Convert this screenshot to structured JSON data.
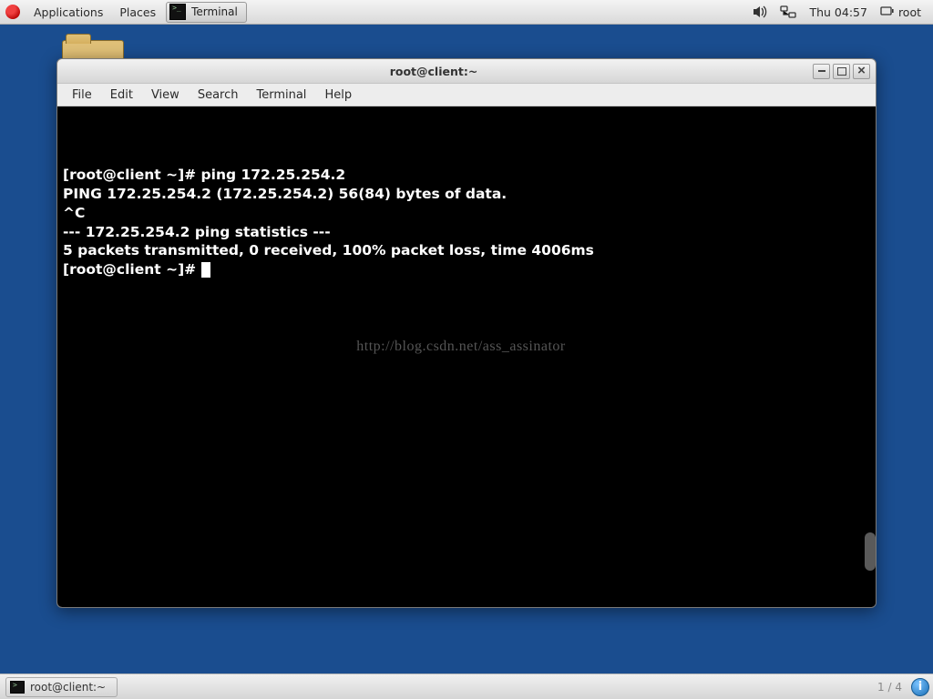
{
  "top_panel": {
    "applications": "Applications",
    "places": "Places",
    "task_terminal": "Terminal",
    "clock": "Thu 04:57",
    "user": "root"
  },
  "desktop": {
    "folder_visible": true
  },
  "window": {
    "title": "root@client:~",
    "menu": {
      "file": "File",
      "edit": "Edit",
      "view": "View",
      "search": "Search",
      "terminal": "Terminal",
      "help": "Help"
    }
  },
  "terminal": {
    "lines": [
      "[root@client ~]# ping 172.25.254.2",
      "PING 172.25.254.2 (172.25.254.2) 56(84) bytes of data.",
      "^C",
      "--- 172.25.254.2 ping statistics ---",
      "5 packets transmitted, 0 received, 100% packet loss, time 4006ms",
      "",
      "[root@client ~]# "
    ],
    "watermark": "http://blog.csdn.net/ass_assinator"
  },
  "bottom_panel": {
    "task": "root@client:~",
    "workspace": "1 / 4"
  }
}
